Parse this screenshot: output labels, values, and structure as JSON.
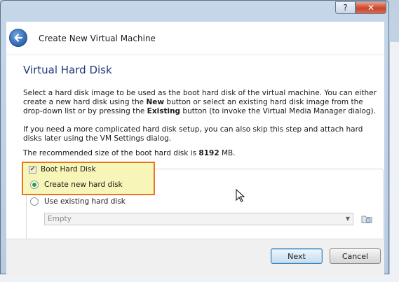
{
  "window": {
    "title": "Create New Virtual Machine",
    "help_label": "?",
    "close_label": "✕"
  },
  "page": {
    "title": "Virtual Hard Disk",
    "p1_a": "Select a hard disk image to be used as the boot hard disk of the virtual machine. You can either create a new hard disk using the ",
    "p1_b": "New",
    "p1_c": " button or select an existing hard disk image from the drop-down list or by pressing the ",
    "p1_d": "Existing",
    "p1_e": " button (to invoke the Virtual Media Manager dialog).",
    "p2": "If you need a more complicated hard disk setup, you can also skip this step and attach hard disks later using the VM Settings dialog.",
    "p3_a": "The recommended size of the boot hard disk is ",
    "p3_b": "8192",
    "p3_c": " MB."
  },
  "options": {
    "boot_label": "Boot Hard Disk",
    "boot_checked": true,
    "create_label": "Create new hard disk",
    "create_selected": true,
    "existing_label": "Use existing hard disk",
    "existing_selected": false
  },
  "combo": {
    "value": "Empty"
  },
  "footer": {
    "next_label": "Next",
    "cancel_label": "Cancel"
  },
  "colors": {
    "highlight_border": "#e8761f",
    "highlight_fill": "#f7f5b7",
    "title_blue": "#1f3b7a"
  }
}
